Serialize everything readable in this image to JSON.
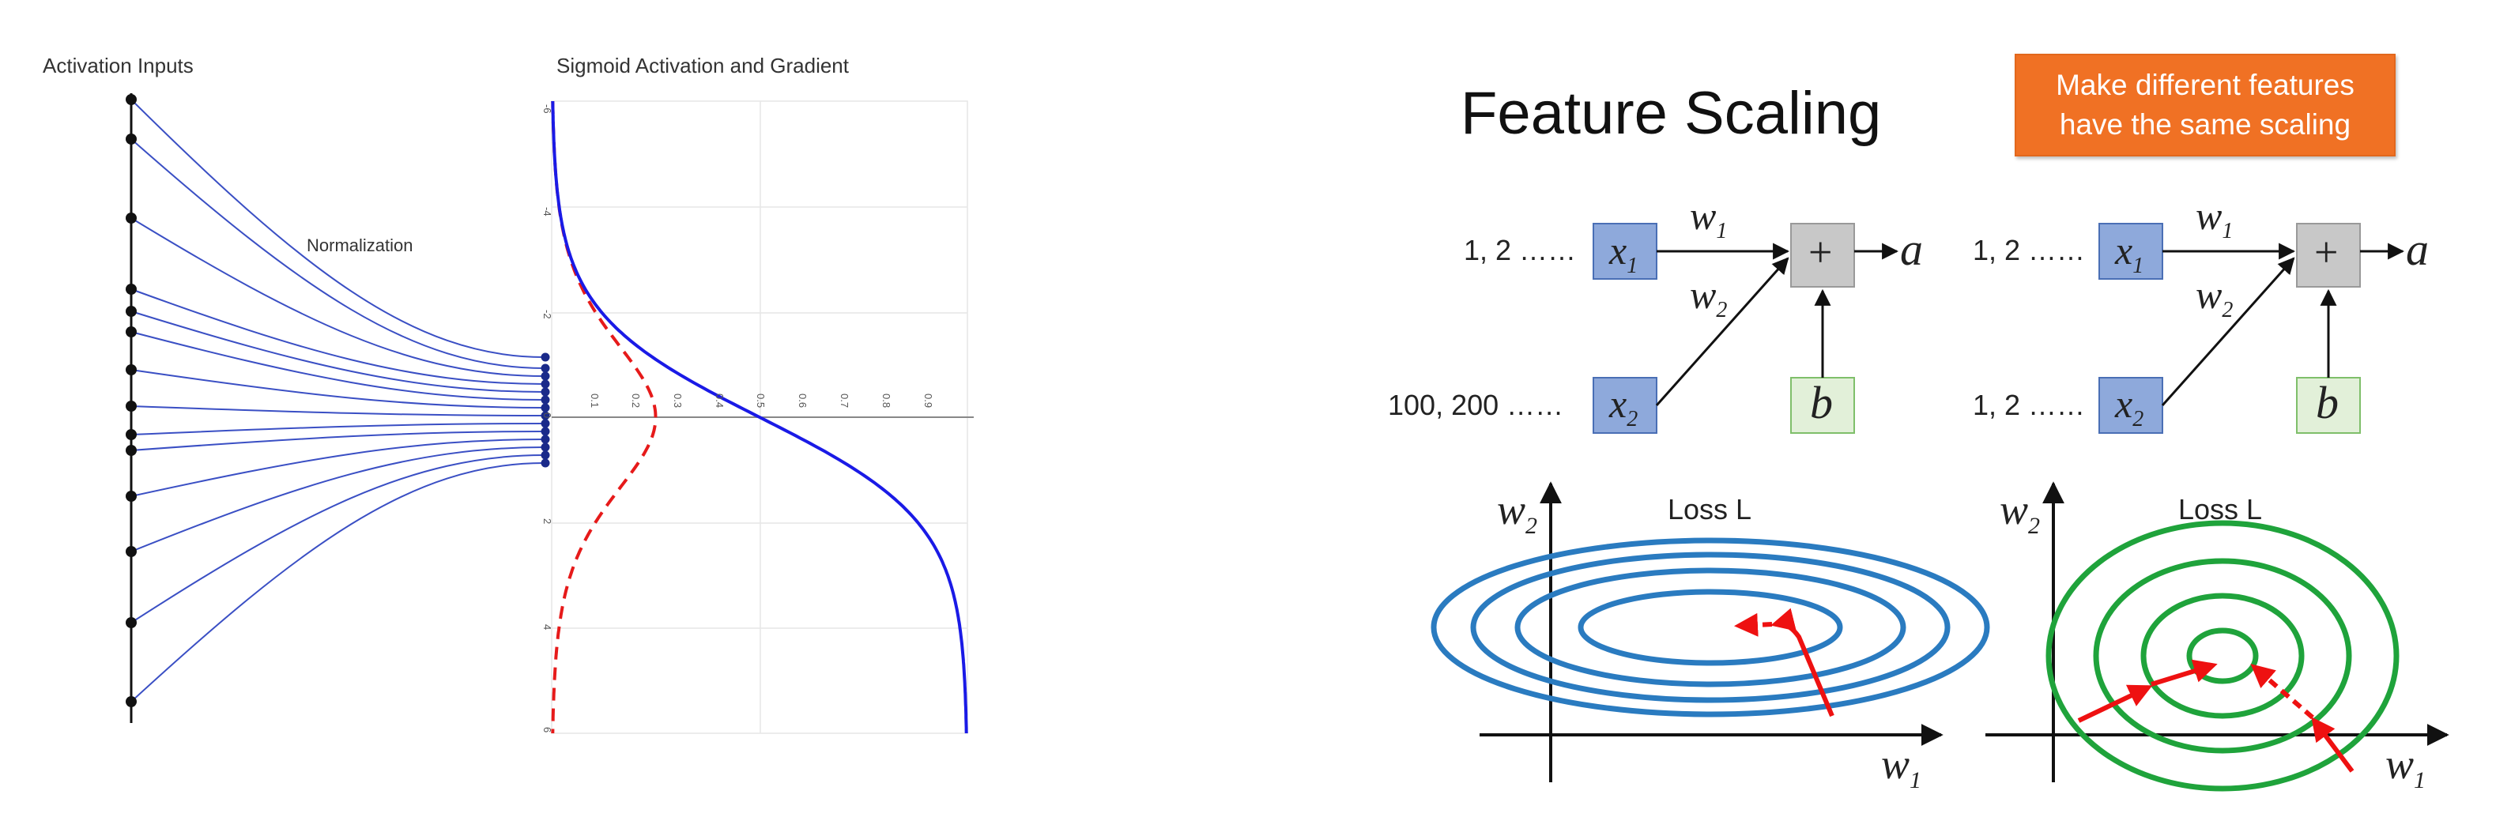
{
  "left_panel": {
    "activation_inputs_title": "Activation Inputs",
    "normalization_label": "Normalization",
    "sigmoid_title": "Sigmoid Activation and Gradient",
    "vertical_ticks": [
      "-6",
      "-4",
      "-2",
      "0",
      "2",
      "4",
      "6"
    ],
    "horizontal_ticks": [
      "0.1",
      "0.2",
      "0.3",
      "0.4",
      "0.5",
      "0.6",
      "0.7",
      "0.8",
      "0.9"
    ]
  },
  "right_panel": {
    "title": "Feature Scaling",
    "callout_line1": "Make different features",
    "callout_line2": "have the same scaling",
    "left_diagram": {
      "x1_values": "1, 2 ……",
      "x2_values": "100, 200 ……",
      "x1": "x",
      "x1_sub": "1",
      "x2": "x",
      "x2_sub": "2",
      "w1": "w",
      "w1_sub": "1",
      "w2": "w",
      "w2_sub": "2",
      "sum": "+",
      "output": "a",
      "bias": "b",
      "loss_label": "Loss L",
      "axis_y": "w",
      "axis_y_sub": "2",
      "axis_x": "w",
      "axis_x_sub": "1"
    },
    "right_diagram": {
      "x1_values": "1, 2 ……",
      "x2_values": "1, 2 ……",
      "x1": "x",
      "x1_sub": "1",
      "x2": "x",
      "x2_sub": "2",
      "w1": "w",
      "w1_sub": "1",
      "w2": "w",
      "w2_sub": "2",
      "sum": "+",
      "output": "a",
      "bias": "b",
      "loss_label": "Loss L",
      "axis_y": "w",
      "axis_y_sub": "2",
      "axis_x": "w",
      "axis_x_sub": "1"
    }
  },
  "colors": {
    "input_lines": "#3a4fc4",
    "sigmoid_curve": "#1a1ae6",
    "gradient_curve": "#e61a1a",
    "input_box_fill": "#8ea9db",
    "bias_box_fill": "#e2f0d9",
    "sum_box_fill": "#c8c8c8",
    "ellipse_blue": "#2a7bc0",
    "circle_green": "#1fa33b",
    "arrow_red": "#ee1111",
    "callout_bg": "#f07124"
  }
}
